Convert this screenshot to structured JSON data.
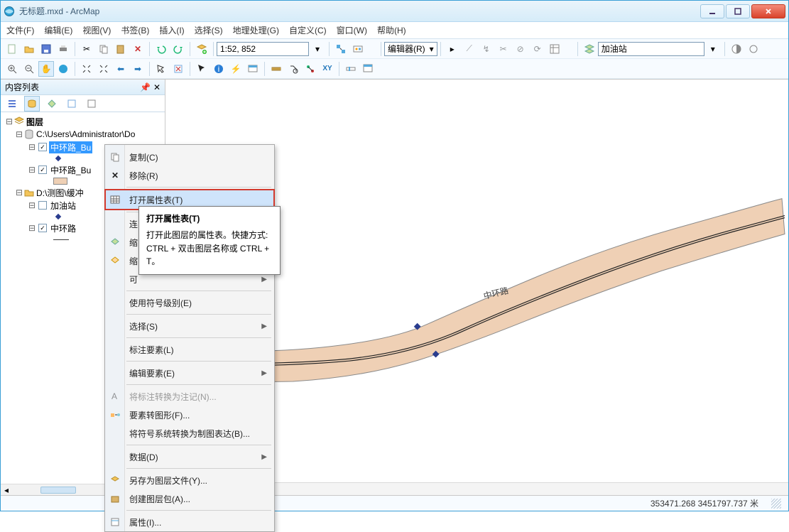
{
  "window": {
    "title": "无标题.mxd - ArcMap"
  },
  "menu": {
    "file": "文件(F)",
    "edit": "编辑(E)",
    "view": "视图(V)",
    "bookmarks": "书签(B)",
    "insert": "插入(I)",
    "selection": "选择(S)",
    "geoprocessing": "地理处理(G)",
    "customize": "自定义(C)",
    "windows": "窗口(W)",
    "help": "帮助(H)"
  },
  "toolbar": {
    "scale": "1:52, 852",
    "editor_label": "编辑器(R)",
    "layer_combo": "加油站"
  },
  "toc": {
    "title": "内容列表",
    "root": "图层",
    "ds1": "C:\\Users\\Administrator\\Do",
    "layer_selected": "中环路_Bu",
    "layer_buffer2": "中环路_Bu",
    "ds2": "D:\\测图\\缓冲",
    "gas": "加油站",
    "ring": "中环路"
  },
  "ctx": {
    "copy": "复制(C)",
    "remove": "移除(R)",
    "open_attr": "打开属性表(T)",
    "join": "连",
    "zoom": "缩",
    "zoom2": "缩",
    "visible": "可",
    "use_symbol_levels": "使用符号级别(E)",
    "selection": "选择(S)",
    "label_features": "标注要素(L)",
    "edit_features": "编辑要素(E)",
    "convert_labels": "将标注转换为注记(N)...",
    "features_to_graphics": "要素转图形(F)...",
    "symbology_to_rep": "将符号系统转换为制图表达(B)...",
    "data": "数据(D)",
    "save_as_layer": "另存为图层文件(Y)...",
    "create_layer_package": "创建图层包(A)...",
    "properties": "属性(I)..."
  },
  "tooltip": {
    "title": "打开属性表(T)",
    "body": "打开此图层的属性表。快捷方式: CTRL + 双击图层名称或 CTRL + T。"
  },
  "status": {
    "coords": "353471.268  3451797.737 米"
  },
  "colors": {
    "buffer_fill": "#efd0b5",
    "buffer_stroke": "#8a8a8a",
    "road": "#222222",
    "point": "#2a3d8f",
    "highlight_border": "#d23a2e"
  }
}
